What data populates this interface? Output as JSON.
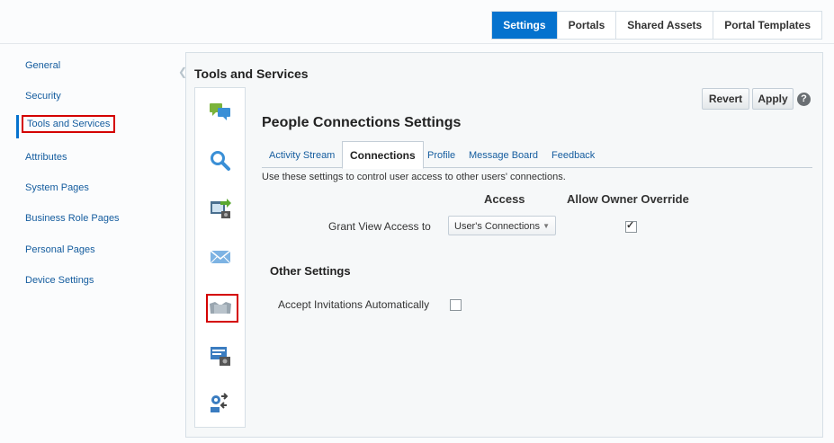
{
  "top_nav": {
    "tabs": [
      {
        "label": "Settings",
        "active": true
      },
      {
        "label": "Portals",
        "active": false
      },
      {
        "label": "Shared Assets",
        "active": false
      },
      {
        "label": "Portal Templates",
        "active": false
      }
    ]
  },
  "left_nav": {
    "items": [
      {
        "label": "General"
      },
      {
        "label": "Security"
      },
      {
        "label": "Tools and Services",
        "active": true
      },
      {
        "label": "Attributes"
      },
      {
        "label": "System Pages"
      },
      {
        "label": "Business Role Pages"
      },
      {
        "label": "Personal Pages"
      },
      {
        "label": "Device Settings"
      }
    ]
  },
  "panel": {
    "title": "Tools and Services",
    "tool_icons": [
      "discussions-icon",
      "search-icon",
      "import-export-icon",
      "mail-icon",
      "people-connections-icon",
      "activity-stream-icon",
      "services-icon"
    ],
    "revert_label": "Revert",
    "apply_label": "Apply",
    "help_label": "?"
  },
  "people_connections": {
    "title": "People Connections Settings",
    "tabs": [
      "Activity Stream",
      "Connections",
      "Profile",
      "Message Board",
      "Feedback"
    ],
    "active_tab": "Connections",
    "description": "Use these settings to control user access to other users' connections.",
    "access_header": "Access",
    "override_header": "Allow Owner Override",
    "grant_label": "Grant View Access to",
    "grant_value": "User's Connections",
    "grant_override_checked": true,
    "other_title": "Other Settings",
    "accept_label": "Accept Invitations Automatically",
    "accept_checked": false
  },
  "colors": {
    "accent": "#0572ce",
    "highlight_border": "#d40000",
    "link": "#145c9e"
  }
}
